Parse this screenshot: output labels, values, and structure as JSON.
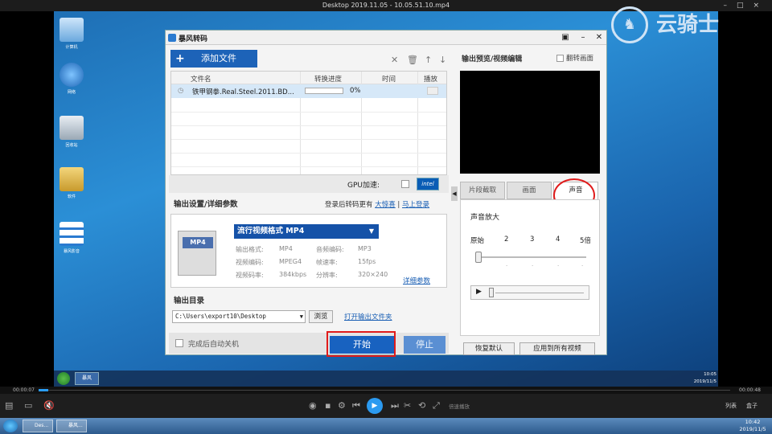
{
  "player_title": "Desktop 2019.11.05 - 10.05.51.10.mp4",
  "watermark": "云骑士",
  "desktop_icons": [
    "计算机",
    "网络",
    "回收站",
    "软件",
    "暴风影音"
  ],
  "app": {
    "title": "暴风转码",
    "add_files": "添加文件",
    "list_headers": {
      "name": "文件名",
      "progress": "转换进度",
      "time": "时间",
      "play": "播放"
    },
    "file_row": {
      "name": "铁甲钢拳.Real.Steel.2011.BD...",
      "percent": "0%",
      "progress_fraction": 0
    },
    "gpu_label": "GPU加速:",
    "intel_badge": "intel",
    "output_settings": "输出设置/详细参数",
    "login_text": "登录后转码更有",
    "login_link_big": "大惊喜",
    "login_link_now": "马上登录",
    "format_icon_label": "MP4",
    "format_select": "流行视频格式  MP4",
    "params": {
      "container_label": "输出格式:",
      "container": "MP4",
      "audio_codec_label": "音频编码:",
      "audio_codec": "MP3",
      "video_codec_label": "视频编码:",
      "video_codec": "MPEG4",
      "framerate_label": "帧速率:",
      "framerate": "15fps",
      "vbitrate_label": "视频码率:",
      "vbitrate": "384kbps",
      "resolution_label": "分辨率:",
      "resolution": "320×240"
    },
    "detail_link": "详细参数",
    "output_dir_label": "输出目录",
    "output_dir": "C:\\Users\\export10\\Desktop",
    "browse": "浏览",
    "open_folder": "打开输出文件夹",
    "auto_shutdown": "完成后自动关机",
    "start": "开始",
    "stop": "停止",
    "preview_title": "输出预览/视频编辑",
    "flip_label": "翻转画面",
    "tabs": [
      "片段截取",
      "画面",
      "声音"
    ],
    "amp_label": "声音放大",
    "amp_ticks": [
      "原始",
      "2",
      "3",
      "4",
      "5倍"
    ],
    "reset": "恢复默认",
    "apply_all": "应用到所有视频"
  },
  "inner_taskbar": {
    "app_label": "暴风",
    "time": "10:05",
    "date": "2019/11/5"
  },
  "player": {
    "time_current": "00:00:07",
    "time_total": "00:00:48",
    "speed": "倍速播放",
    "list": "列表",
    "box": "盒子",
    "progress_fraction": 0.015
  },
  "host_taskbar": {
    "btn1": "Des...",
    "btn2": "暴风...",
    "time": "10:42",
    "date": "2019/11/5"
  },
  "colors": {
    "accent": "#1862c0",
    "highlight_red": "#e01b1b",
    "play_blue": "#2b9af0"
  }
}
